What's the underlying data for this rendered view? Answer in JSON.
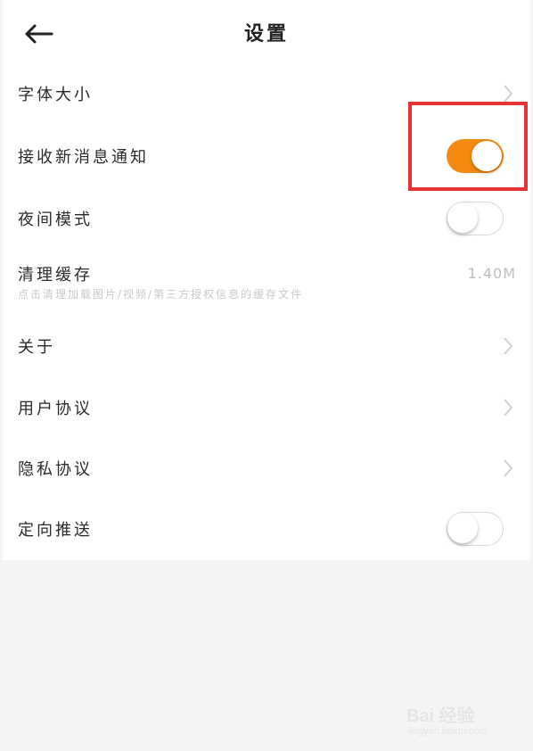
{
  "header": {
    "title": "设置",
    "back_icon": "arrow-left-icon"
  },
  "settings": {
    "font_size": {
      "label": "字体大小",
      "icon": "chevron-right-icon"
    },
    "notifications": {
      "label": "接收新消息通知",
      "toggle_on": true
    },
    "night_mode": {
      "label": "夜间模式",
      "toggle_on": false
    },
    "cache": {
      "label": "清理缓存",
      "description": "点击清理加载图片/视频/第三方授权信息的缓存文件",
      "size": "1.40M"
    },
    "about": {
      "label": "关于",
      "icon": "chevron-right-icon"
    },
    "user_agreement": {
      "label": "用户协议",
      "icon": "chevron-right-icon"
    },
    "privacy_agreement": {
      "label": "隐私协议",
      "icon": "chevron-right-icon"
    },
    "targeted_push": {
      "label": "定向推送",
      "toggle_on": false
    }
  },
  "colors": {
    "accent": "#f58a12",
    "highlight": "#e83333"
  },
  "watermark": {
    "logo_text": "Bai 经验",
    "url": "jingyan.baidu.com"
  }
}
